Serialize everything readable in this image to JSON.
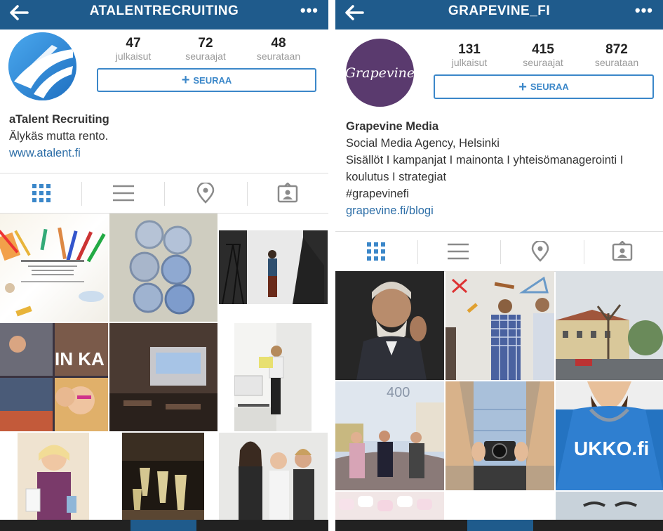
{
  "left": {
    "title": "ATALENTRECRUITING",
    "stats": [
      {
        "num": "47",
        "label": "julkaisut"
      },
      {
        "num": "72",
        "label": "seuraajat"
      },
      {
        "num": "48",
        "label": "seurataan"
      }
    ],
    "follow_label": "SEURAA",
    "bio": {
      "name": "aTalent Recruiting",
      "line1": "Älykäs mutta rento.",
      "link": "www.atalent.fi"
    }
  },
  "right": {
    "title": "GRAPEVINE_FI",
    "avatar_text": "Grapevine",
    "stats": [
      {
        "num": "131",
        "label": "julkaisut"
      },
      {
        "num": "415",
        "label": "seuraajat"
      },
      {
        "num": "872",
        "label": "seurataan"
      }
    ],
    "follow_label": "SEURAA",
    "bio": {
      "name": "Grapevine Media",
      "line1": "Social Media Agency, Helsinki",
      "line2": "Sisällöt I kampanjat I mainonta I yhteisömanagerointi I",
      "line3": "koulutus I strategiat",
      "line4": "#grapevinefi",
      "link": "grapevine.fi/blogi"
    },
    "tile_text_400": "400",
    "tile_text_ukko": "UKKO.fi"
  },
  "colors": {
    "topbar": "#1f5b8c",
    "accent": "#3b87c9",
    "link": "#2d6ea7"
  }
}
